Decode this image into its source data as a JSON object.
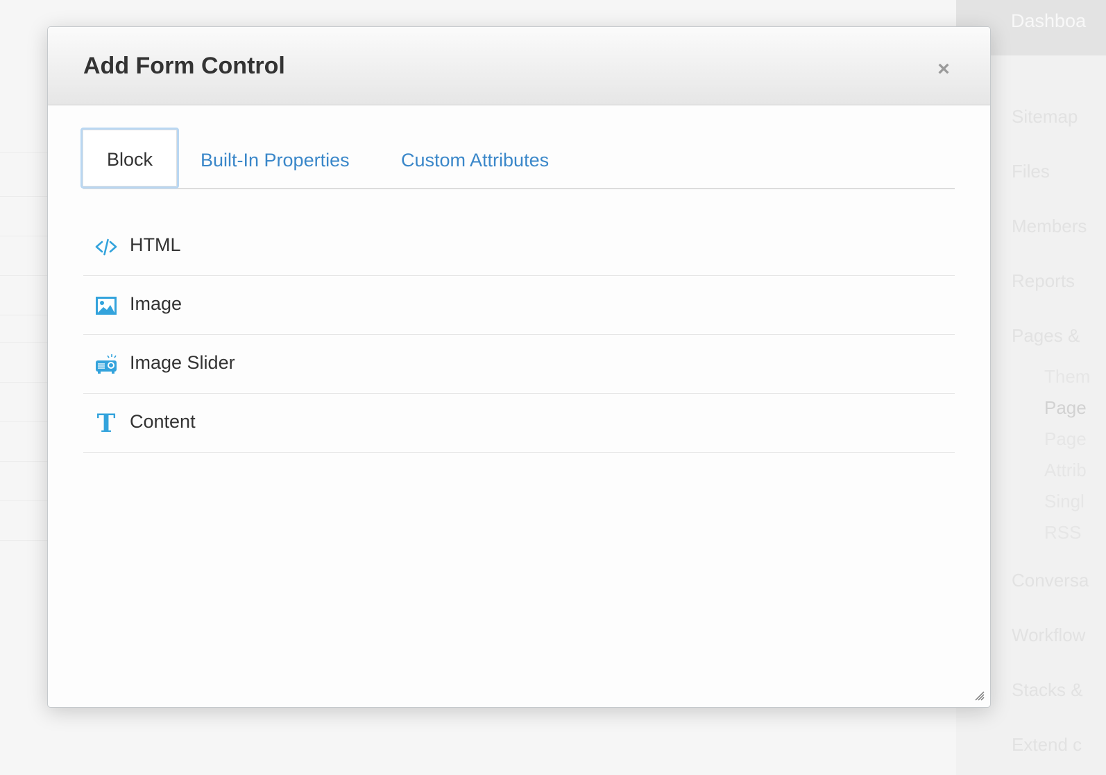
{
  "background": {
    "sidebar": {
      "top_label": "Dashboa",
      "items": [
        "Sitemap",
        "Files",
        "Members",
        "Reports",
        "Pages &"
      ],
      "subitems": [
        "Them",
        "Page",
        "Page",
        "Attrib",
        "Singl",
        "RSS"
      ],
      "items_after": [
        "Conversa",
        "Workflow",
        "Stacks &",
        "Extend c"
      ]
    }
  },
  "modal": {
    "title": "Add Form Control",
    "close_symbol": "×",
    "tabs": [
      {
        "label": "Block",
        "active": true
      },
      {
        "label": "Built-In Properties",
        "active": false
      },
      {
        "label": "Custom Attributes",
        "active": false
      }
    ],
    "blocks": [
      {
        "label": "HTML",
        "icon": "code-icon"
      },
      {
        "label": "Image",
        "icon": "image-icon"
      },
      {
        "label": "Image Slider",
        "icon": "projector-icon"
      },
      {
        "label": "Content",
        "icon": "text-t-icon",
        "glyph": "T"
      }
    ]
  },
  "colors": {
    "accent_icon": "#33a3dc",
    "tab_link": "#3a87c9",
    "active_tab_border": "#b9d7f2"
  }
}
